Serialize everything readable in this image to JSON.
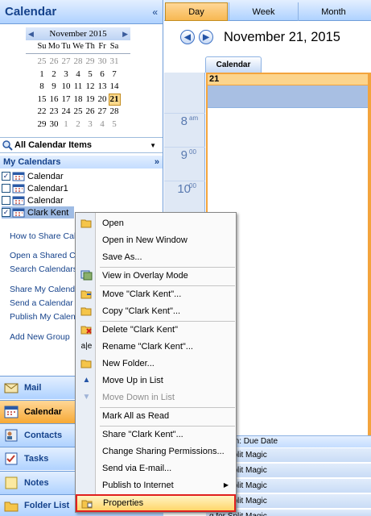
{
  "nav": {
    "title": "Calendar",
    "collapse_glyph": "«",
    "mini_cal": {
      "month": "November 2015",
      "prev": "◀",
      "next": "▶",
      "day_headers": [
        "Su",
        "Mo",
        "Tu",
        "We",
        "Th",
        "Fr",
        "Sa"
      ],
      "weeks": [
        [
          "25",
          "26",
          "27",
          "28",
          "29",
          "30",
          "31"
        ],
        [
          "1",
          "2",
          "3",
          "4",
          "5",
          "6",
          "7"
        ],
        [
          "8",
          "9",
          "10",
          "11",
          "12",
          "13",
          "14"
        ],
        [
          "15",
          "16",
          "17",
          "18",
          "19",
          "20",
          "21"
        ],
        [
          "22",
          "23",
          "24",
          "25",
          "26",
          "27",
          "28"
        ],
        [
          "29",
          "30",
          "1",
          "2",
          "3",
          "4",
          "5"
        ]
      ],
      "today": "21"
    },
    "all_items": "All Calendar Items",
    "my_calendars": "My Calendars",
    "calendars": [
      {
        "label": "Calendar",
        "checked": true
      },
      {
        "label": "Calendar1",
        "checked": false
      },
      {
        "label": "Calendar",
        "checked": false
      },
      {
        "label": "Clark Kent",
        "checked": true
      }
    ],
    "links": [
      "How to Share Cal",
      "Open a Shared C",
      "Search Calendars",
      "Share My Calend",
      "Send a Calendar v",
      "Publish My Calen",
      "Add New Group"
    ],
    "buttons": [
      "Mail",
      "Calendar",
      "Contacts",
      "Tasks",
      "Notes",
      "Folder List"
    ]
  },
  "view_tabs": [
    "Day",
    "Week",
    "Month"
  ],
  "date_title": "November 21, 2015",
  "calendar_tab": "Calendar",
  "day_number": "21",
  "hours": [
    {
      "h": "8",
      "m": "am"
    },
    {
      "h": "9",
      "m": "00"
    },
    {
      "h": "10",
      "m": "00"
    }
  ],
  "task_header": "tasks on: Due Date",
  "task_rows": [
    "g for Split Magic",
    "g for Split Magic",
    "g for Split Magic",
    "g for Split Magic",
    "g for Split Magic"
  ],
  "context_menu": {
    "open": "Open",
    "open_new_window": "Open in New Window",
    "save_as": "Save As...",
    "view_overlay": "View in Overlay Mode",
    "move": "Move \"Clark Kent\"...",
    "copy": "Copy \"Clark Kent\"...",
    "delete": "Delete \"Clark Kent\"",
    "rename": "Rename \"Clark Kent\"...",
    "new_folder": "New Folder...",
    "move_up": "Move Up in List",
    "move_down": "Move Down in List",
    "mark_all_read": "Mark All as Read",
    "share": "Share \"Clark Kent\"...",
    "change_sharing": "Change Sharing Permissions...",
    "send_email": "Send via E-mail...",
    "publish": "Publish to Internet",
    "properties": "Properties"
  },
  "colors": {
    "accent_blue": "#15428b",
    "today_orange": "#f3a43d",
    "highlight_red": "#e0201f"
  }
}
